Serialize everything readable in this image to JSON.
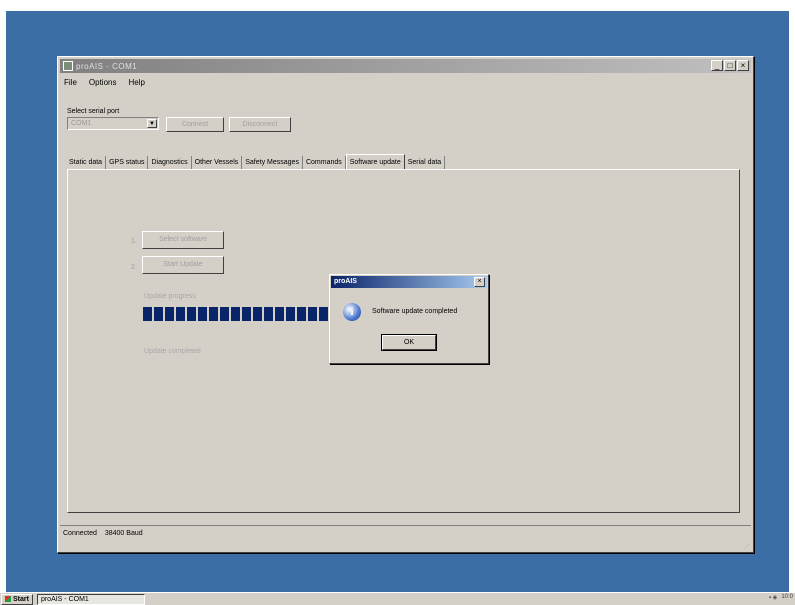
{
  "window": {
    "title": "proAIS - COM1",
    "min_label": "_",
    "max_label": "□",
    "close_label": "×"
  },
  "menu": [
    "File",
    "Options",
    "Help"
  ],
  "serial": {
    "label": "Select serial port",
    "value": "COM1",
    "connect_label": "Connect",
    "disconnect_label": "Disconnect"
  },
  "tabs": [
    "Static data",
    "GPS status",
    "Diagnostics",
    "Other Vessels",
    "Safety Messages",
    "Commands",
    "Software update",
    "Serial data"
  ],
  "active_tab": 6,
  "update": {
    "step1_num": "1.",
    "step1_button": "Select software",
    "step2_num": "2.",
    "step2_button": "Start Update",
    "progress_label": "Update progress",
    "progress_value": 1.0,
    "status_text": "Update completed"
  },
  "statusbar": {
    "connection": "Connected",
    "baud": "38400 Baud"
  },
  "dialog": {
    "title": "proAIS",
    "close_label": "×",
    "icon": "info-icon",
    "message": "Software update completed",
    "ok_label": "OK"
  },
  "taskbar": {
    "start_label": "Start",
    "task_label": "proAIS - COM1",
    "tray_time": "10:0"
  },
  "colors": {
    "desktop": "#3a6ea5",
    "progress": "#0a246a",
    "dialog_title": "#0a246a"
  }
}
